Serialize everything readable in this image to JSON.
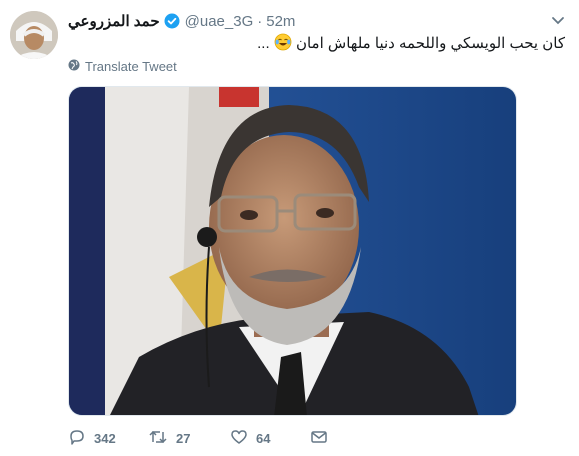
{
  "tweet": {
    "author_name": "حمد المزروعي",
    "handle": "@uae_3G",
    "separator": "·",
    "time": "52m",
    "text": "كان يحب الويسكي واللحمه دنيا ملهاش امان",
    "trailing_text": " ...",
    "translate_label": "Translate Tweet",
    "reply_count": "342",
    "retweet_count": "27",
    "like_count": "64"
  },
  "icons": {
    "verified": "verified-badge-icon",
    "caret": "chevron-down-icon",
    "globe": "globe-icon",
    "reply": "reply-icon",
    "retweet": "retweet-icon",
    "like": "heart-icon",
    "dm": "envelope-icon",
    "emoji": "face-with-tears-of-joy"
  },
  "colors": {
    "verified_blue": "#1da1f2",
    "secondary_text": "#657786",
    "primary_text": "#14171a",
    "media_background_blue": "#1f4f93"
  }
}
